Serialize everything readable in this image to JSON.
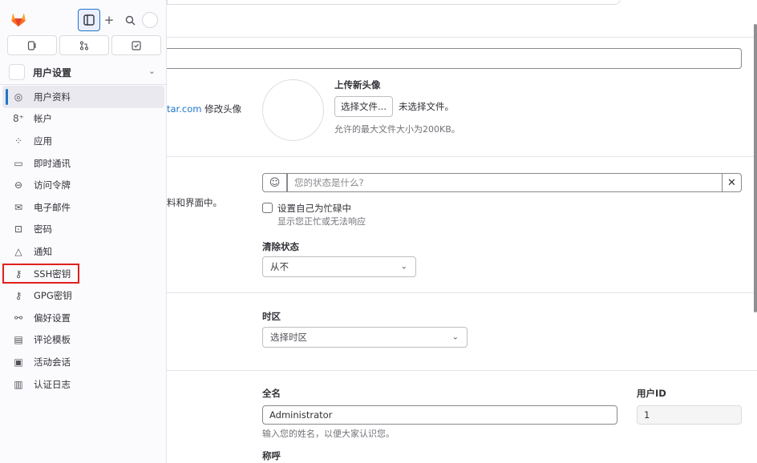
{
  "sidebar": {
    "context_title": "用户设置",
    "items": [
      {
        "label": "用户资料",
        "icon": "profile-icon",
        "active": true
      },
      {
        "label": "帐户",
        "icon": "account-icon"
      },
      {
        "label": "应用",
        "icon": "applications-icon"
      },
      {
        "label": "即时通讯",
        "icon": "chat-icon"
      },
      {
        "label": "访问令牌",
        "icon": "token-icon"
      },
      {
        "label": "电子邮件",
        "icon": "mail-icon"
      },
      {
        "label": "密码",
        "icon": "lock-icon"
      },
      {
        "label": "通知",
        "icon": "bell-icon"
      },
      {
        "label": "SSH密钥",
        "icon": "key-icon",
        "highlighted": true
      },
      {
        "label": "GPG密钥",
        "icon": "key-icon"
      },
      {
        "label": "偏好设置",
        "icon": "preferences-icon"
      },
      {
        "label": "评论模板",
        "icon": "comment-template-icon"
      },
      {
        "label": "活动会话",
        "icon": "sessions-icon"
      },
      {
        "label": "认证日志",
        "icon": "log-icon"
      }
    ]
  },
  "avatar_section": {
    "partial_text_link": "tar.com",
    "partial_text_after": "修改头像",
    "upload_title": "上传新头像",
    "choose_file_button": "选择文件...",
    "no_file_text": "未选择文件。",
    "max_size_help": "允许的最大文件大小为200KB。"
  },
  "status_section": {
    "partial_text": "料和界面中。",
    "status_placeholder": "您的状态是什么?",
    "busy_label": "设置自己为忙碌中",
    "busy_help": "显示您正忙或无法响应",
    "clear_status_label": "清除状态",
    "clear_status_value": "从不"
  },
  "timezone_section": {
    "label": "时区",
    "placeholder": "选择时区"
  },
  "main_settings": {
    "full_name_label": "全名",
    "full_name_value": "Administrator",
    "full_name_help": "输入您的姓名，以便大家认识您。",
    "user_id_label": "用户ID",
    "user_id_value": "1",
    "pronouns_label": "称呼"
  },
  "colors": {
    "accent": "#1f75cb",
    "highlight_box": "#e0201d",
    "logo_orange": "#e24329"
  }
}
